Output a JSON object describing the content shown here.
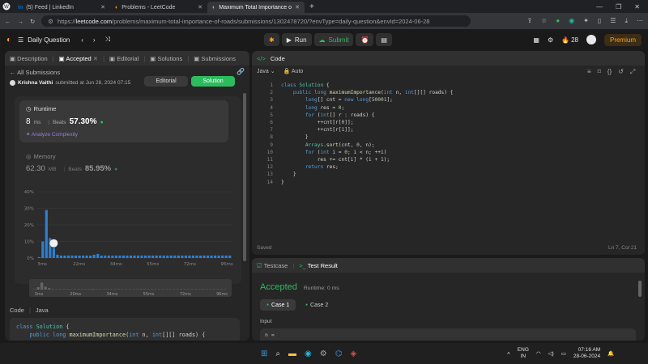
{
  "browser": {
    "tabs": [
      {
        "label": "(5) Feed | LinkedIn",
        "icon": "in"
      },
      {
        "label": "Problems - LeetCode",
        "icon": "lc"
      },
      {
        "label": "Maximum Total Importance of R",
        "icon": "lc"
      }
    ],
    "url_host": "leetcode.com",
    "url_path": "/problems/maximum-total-importance-of-roads/submissions/1302478720/?envType=daily-question&envId=2024-06-28",
    "url_prefix": "https://"
  },
  "header": {
    "daily_label": "Daily Question",
    "run_label": "Run",
    "submit_label": "Submit",
    "streak": "28",
    "premium_label": "Premium"
  },
  "left": {
    "tabs": [
      "Description",
      "Accepted",
      "Editorial",
      "Solutions",
      "Submissions"
    ],
    "all_submissions": "All Submissions",
    "author": "Krishna Vaithi",
    "submitted_text": "submitted at Jun 28, 2024 07:15",
    "editorial_btn": "Editorial",
    "solution_btn": "Solution",
    "runtime_title": "Runtime",
    "runtime_value": "8",
    "runtime_unit": "ms",
    "beats_label": "Beats",
    "runtime_beats": "57.30%",
    "analyze_label": "Analyze Complexity",
    "memory_title": "Memory",
    "memory_value": "62.30",
    "memory_unit": "MB",
    "memory_beats": "85.95%",
    "code_label": "Code",
    "lang_label": "Java",
    "code_preview": [
      "class Solution {",
      "    public long maximumImportance(int n, int[][] roads) {"
    ]
  },
  "chart_data": {
    "type": "bar",
    "y_ticks": [
      "40%",
      "30%",
      "20%",
      "10%",
      "0%"
    ],
    "ylim": [
      0,
      40
    ],
    "x_ticks": [
      "3ms",
      "22ms",
      "34ms",
      "55ms",
      "72ms",
      "95ms"
    ],
    "mini_ticks": [
      "3ms",
      "20ms",
      "34ms",
      "55ms",
      "72ms",
      "96ms"
    ],
    "values": [
      0.6,
      10,
      29,
      12,
      6,
      2,
      1.5,
      1.5,
      1.5,
      1.5,
      1.5,
      1.5,
      1.5,
      1.5,
      1.5,
      2,
      2.5,
      1.5,
      1.5,
      1.5,
      1.5,
      1.5,
      1.5,
      1.5,
      1.5,
      1.5,
      1.5,
      1.5,
      1.5,
      1.5,
      1.5,
      1.5,
      1.5,
      1.5,
      1.5,
      1.5,
      1.5,
      1.5,
      1.5,
      1.5,
      1.5,
      1.5,
      1.5,
      1.5,
      1.5,
      1.5,
      1.5,
      1.5,
      1.5,
      1.5,
      1.5,
      1.5,
      1.5
    ],
    "highlight_index": 4,
    "colors": {
      "bar": "#2d7fd1",
      "grid": "#3a3a3a"
    }
  },
  "editor": {
    "title": "Code",
    "lang": "Java",
    "auto": "Auto",
    "lines": [
      "class Solution {",
      "    public long maximumImportance(int n, int[][] roads) {",
      "        long[] cnt = new long[50001];",
      "        long res = 0;",
      "        for (int[] r : roads) {",
      "            ++cnt[r[0]];",
      "            ++cnt[r[1]];",
      "        }",
      "        Arrays.sort(cnt, 0, n);",
      "        for (int i = 0; i < n; ++i)",
      "            res += cnt[i] * (i + 1);",
      "        return res;",
      "    }",
      "}"
    ],
    "saved": "Saved",
    "cursor": "Ln 7, Col 21"
  },
  "result": {
    "tab_testcase": "Testcase",
    "tab_result": "Test Result",
    "status": "Accepted",
    "runtime": "Runtime: 0 ms",
    "case1": "Case 1",
    "case2": "Case 2",
    "input_label": "Input",
    "input_value": "n ="
  },
  "taskbar": {
    "lang": "ENG",
    "region": "IN",
    "time": "07:16 AM",
    "date": "28-06-2024"
  },
  "colors": {
    "accent_green": "#2cbb5d",
    "accent_orange": "#ffa116",
    "accepted": "#2cbb5d"
  }
}
